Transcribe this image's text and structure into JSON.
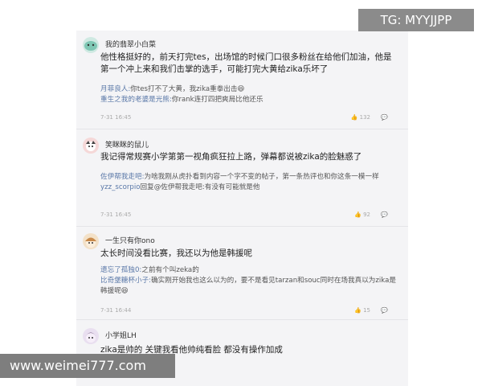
{
  "watermark_tg": "TG: MYYJJPP",
  "watermark_site": "www.weimei777.com",
  "comments": [
    {
      "user": "我的翡翠小白菜",
      "text": "他性格挺好的，前天打完tes，出场馆的时候门口很多粉丝在给他们加油，他是第一个冲上来和我们击掌的选手，可能打完大黄给zika乐坏了",
      "replies": [
        {
          "name": "月菲良人:",
          "text": "你tes打不了大黄，我zika重拳出击😆"
        },
        {
          "name": "重生之我的老婆是光熊:",
          "text": "你rank连打四把爽局比他还乐"
        }
      ],
      "time": "7-31 16:45",
      "likes": "132"
    },
    {
      "user": "笑眯眯的鼠儿",
      "text": "我记得常规赛小学第第一视角疯狂拉上路，弹幕都说被zika的脸魅惑了",
      "replies": [
        {
          "name": "佐伊帮我走吧:",
          "text": "为啥我刚从虎扑看到内容一个字不变的帖子，第一条热评也和你这条一模一样"
        },
        {
          "name": "yzz_scorpio",
          "text": "回复@佐伊帮我走吧:有没有可能就是他"
        }
      ],
      "time": "7-31 16:45",
      "likes": "92"
    },
    {
      "user": "一生只有你ono",
      "text": "太长时间没看比赛，我还以为他是韩援呢",
      "replies": [
        {
          "name": "遗忘了孤独0:",
          "text": "之前有个叫zeka的"
        },
        {
          "name": "比奇堡糖杯小子:",
          "text": "确实刚开始我也这么以为的，要不是看见tarzan和souc同时在场我真以为zika是韩援呢😆"
        }
      ],
      "time": "7-31 16:44",
      "likes": "15"
    },
    {
      "user": "小学姐LH",
      "text": "zika是帅的 关键我看他帅纯看脸 都没有操作加成",
      "replies": [],
      "time": "",
      "likes": ""
    }
  ]
}
